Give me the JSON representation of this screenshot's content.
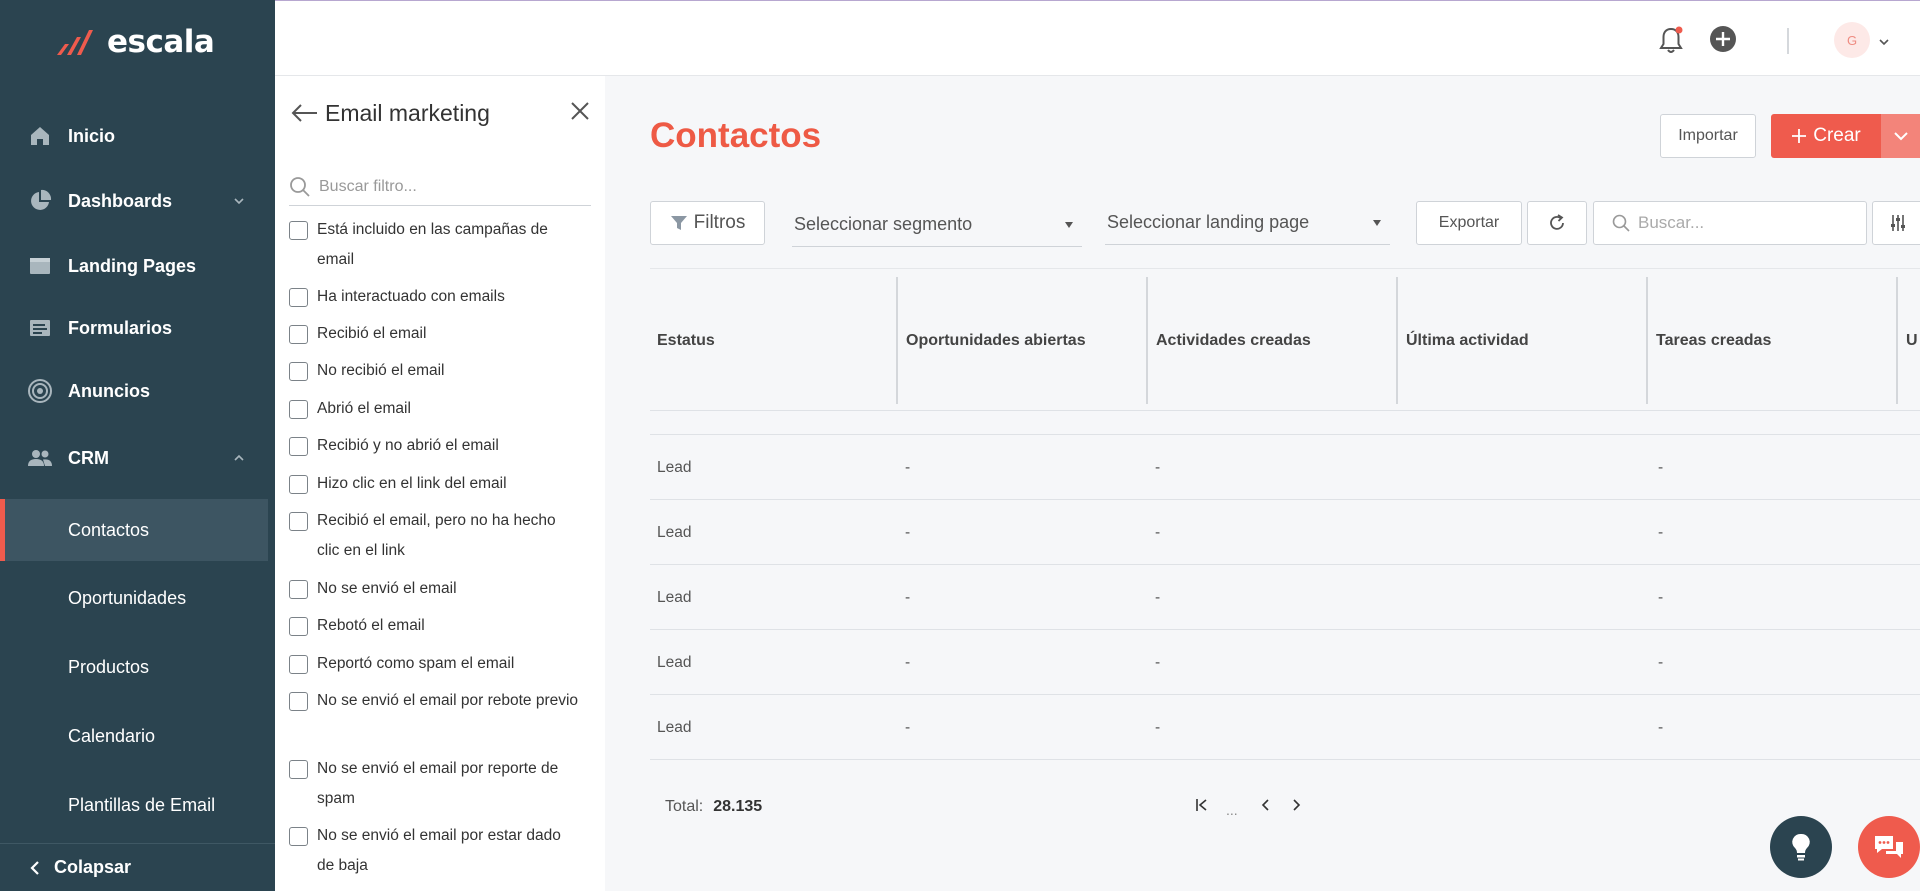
{
  "brand": {
    "name": "escala",
    "tm": "™",
    "accent": "#ef5b4d",
    "sidebar_bg": "#2b4450"
  },
  "sidebar": {
    "items": [
      {
        "label": "Inicio",
        "icon": "home-icon"
      },
      {
        "label": "Dashboards",
        "icon": "pie-chart-icon",
        "chevron": "chevron-down-icon"
      },
      {
        "label": "Landing Pages",
        "icon": "browser-window-icon"
      },
      {
        "label": "Formularios",
        "icon": "form-icon"
      },
      {
        "label": "Anuncios",
        "icon": "target-icon"
      },
      {
        "label": "CRM",
        "icon": "users-icon",
        "chevron": "chevron-up-icon"
      }
    ],
    "sub_items": [
      {
        "label": "Contactos",
        "active": true
      },
      {
        "label": "Oportunidades"
      },
      {
        "label": "Productos"
      },
      {
        "label": "Calendario"
      },
      {
        "label": "Plantillas de Email"
      }
    ],
    "collapse_label": "Colapsar"
  },
  "topbar": {
    "icons": [
      "bell-icon",
      "add-circle-icon"
    ],
    "avatar_initial": "G"
  },
  "filter_panel": {
    "title": "Email marketing",
    "search_placeholder": "Buscar filtro...",
    "options": [
      "Está incluido en las campañas de email",
      "Ha interactuado con emails",
      "Recibió el email",
      "No recibió el email",
      "Abrió el email",
      "Recibió y no abrió el email",
      "Hizo clic en el link del email",
      "Recibió el email, pero no ha hecho clic en el link",
      "No se envió el email",
      "Rebotó el email",
      "Reportó como spam el email",
      "No se envió el email por rebote previo",
      "No se envió el email por reporte de spam",
      "No se envió el email por estar dado de baja"
    ]
  },
  "main": {
    "title": "Contactos",
    "import_label": "Importar",
    "create_label": "Crear",
    "filters_label": "Filtros",
    "segment_placeholder": "Seleccionar segmento",
    "landing_placeholder": "Seleccionar landing page",
    "export_label": "Exportar",
    "search_placeholder": "Buscar..."
  },
  "table": {
    "columns": [
      "Estatus",
      "Oportunidades abiertas",
      "Actividades creadas",
      "Última actividad",
      "Tareas creadas",
      "U"
    ],
    "rows": [
      [
        "Lead",
        "-",
        "-",
        "",
        "-"
      ],
      [
        "Lead",
        "-",
        "-",
        "",
        "-"
      ],
      [
        "Lead",
        "-",
        "-",
        "",
        "-"
      ],
      [
        "Lead",
        "-",
        "-",
        "",
        "-"
      ],
      [
        "Lead",
        "-",
        "-",
        "",
        "-"
      ]
    ],
    "total_label": "Total:",
    "total_value": "28.135",
    "pager_dots": "..."
  }
}
